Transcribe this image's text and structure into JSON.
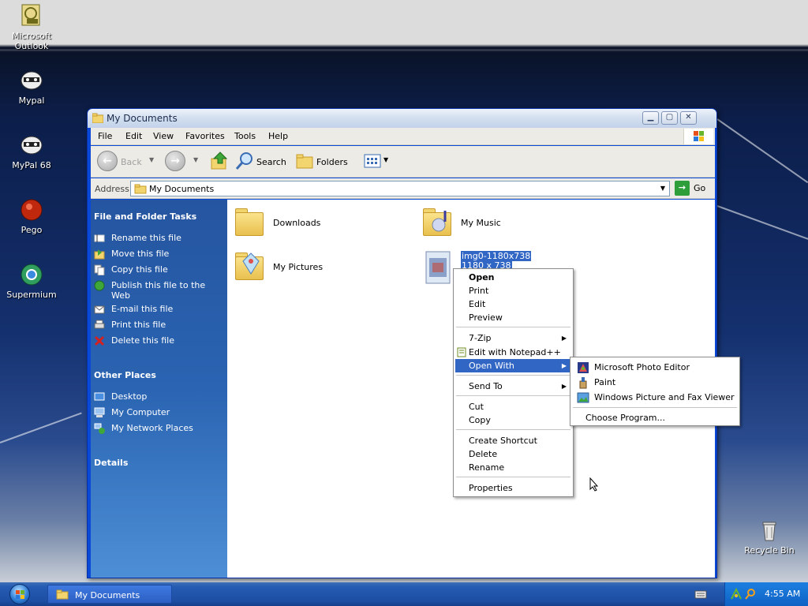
{
  "desktop": {
    "icons": [
      {
        "label": "Microsoft Outlook",
        "name": "outlook"
      },
      {
        "label": "Mypal",
        "name": "mypal"
      },
      {
        "label": "MyPal 68",
        "name": "mypal-68"
      },
      {
        "label": "Pego",
        "name": "pego"
      },
      {
        "label": "Supermium",
        "name": "supermium"
      },
      {
        "label": "Recycle Bin",
        "name": "recycle-bin"
      }
    ]
  },
  "window": {
    "title": "My Documents",
    "menu": [
      "File",
      "Edit",
      "View",
      "Favorites",
      "Tools",
      "Help"
    ],
    "toolbar": {
      "back": "Back",
      "search": "Search",
      "folders": "Folders"
    },
    "address": {
      "label": "Address",
      "value": "My Documents",
      "go": "Go"
    }
  },
  "leftpane": {
    "file_tasks_title": "File and Folder Tasks",
    "file_tasks": [
      "Rename this file",
      "Move this file",
      "Copy this file",
      "Publish this file to the Web",
      "E-mail this file",
      "Print this file",
      "Delete this file"
    ],
    "other_places_title": "Other Places",
    "other_places": [
      "Desktop",
      "My Computer",
      "My Network Places"
    ],
    "details_title": "Details"
  },
  "files": [
    {
      "name": "Downloads"
    },
    {
      "name": "My Music"
    },
    {
      "name": "My Pictures"
    },
    {
      "name": "img0-1180x738",
      "subtitle": "1180 x 738"
    }
  ],
  "context_menu": {
    "items": {
      "open": "Open",
      "print": "Print",
      "edit": "Edit",
      "preview": "Preview",
      "zip": "7-Zip",
      "notepad": "Edit with Notepad++",
      "open_with": "Open With",
      "send_to": "Send To",
      "cut": "Cut",
      "copy": "Copy",
      "create_shortcut": "Create Shortcut",
      "delete": "Delete",
      "rename": "Rename",
      "properties": "Properties"
    }
  },
  "open_with_menu": {
    "items": [
      "Microsoft Photo Editor",
      "Paint",
      "Windows Picture and Fax Viewer"
    ],
    "choose": "Choose Program..."
  },
  "taskbar": {
    "task": "My Documents",
    "clock": "4:55 AM"
  },
  "colors": {
    "selection": "#3166c5",
    "leftpane_top": "#2555a0",
    "taskbar": "#245bb2"
  }
}
